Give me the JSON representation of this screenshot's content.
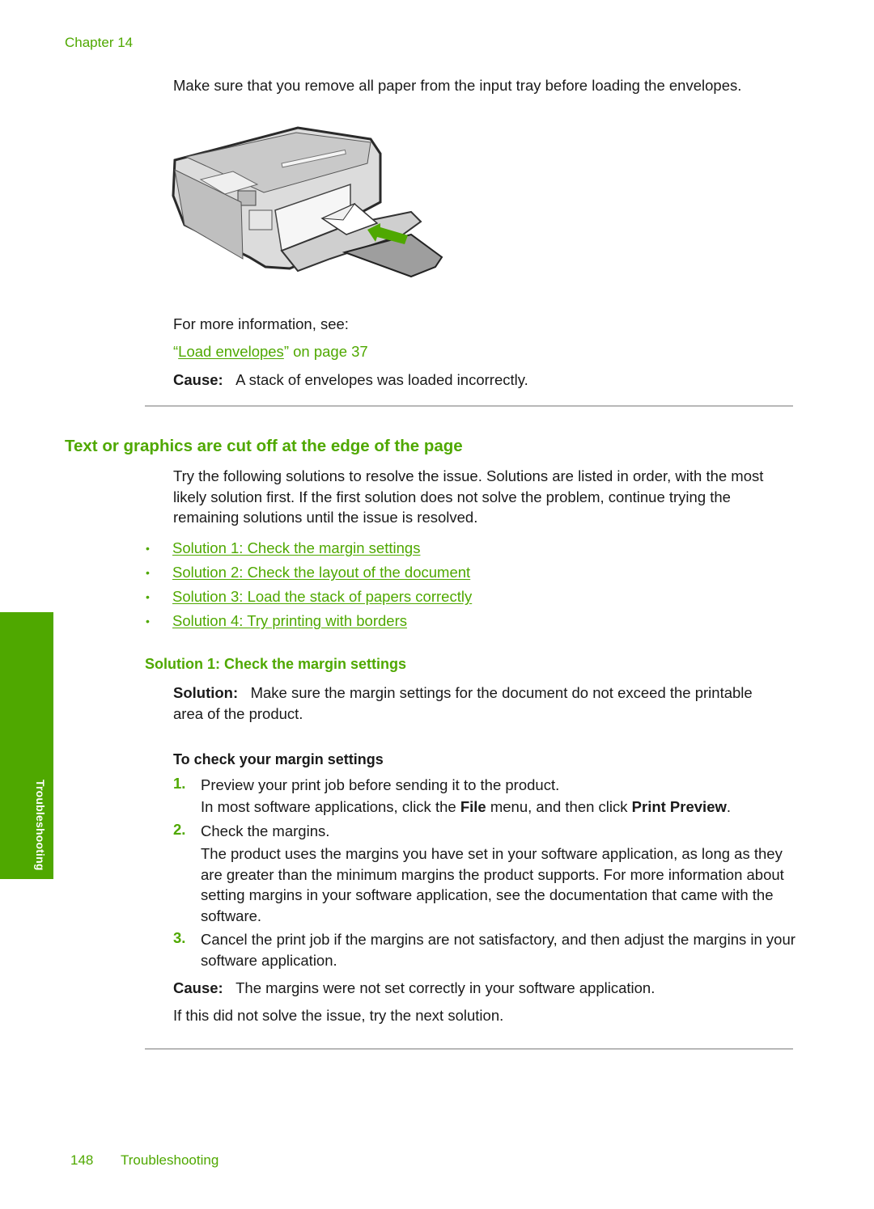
{
  "header": {
    "chapter": "Chapter 14"
  },
  "intro": {
    "remove_paper": "Make sure that you remove all paper from the input tray before loading the envelopes.",
    "figure_alt": "Printer with envelope being loaded into input tray (green arrow indicates direction)",
    "more_info": "For more information, see:",
    "link_open_quote": "“",
    "link_text": "Load envelopes",
    "link_suffix": "” on page 37",
    "cause_label": "Cause:",
    "cause_text": "A stack of envelopes was loaded incorrectly."
  },
  "section": {
    "title": "Text or graphics are cut off at the edge of the page",
    "intro": "Try the following solutions to resolve the issue. Solutions are listed in order, with the most likely solution first. If the first solution does not solve the problem, continue trying the remaining solutions until the issue is resolved.",
    "solutions": [
      {
        "label": "Solution 1: Check the margin settings"
      },
      {
        "label": "Solution 2: Check the layout of the document"
      },
      {
        "label": "Solution 3: Load the stack of papers correctly"
      },
      {
        "label": "Solution 4: Try printing with borders"
      }
    ],
    "bullet": "•"
  },
  "solution1": {
    "title": "Solution 1: Check the margin settings",
    "solution_label": "Solution:",
    "solution_text": "Make sure the margin settings for the document do not exceed the printable area of the product.",
    "procedure_title": "To check your margin settings",
    "steps": [
      {
        "num": "1.",
        "text": "Preview your print job before sending it to the product.",
        "detail_pre": "In most software applications, click the ",
        "detail_b1": "File",
        "detail_mid": " menu, and then click ",
        "detail_b2": "Print Preview",
        "detail_post": "."
      },
      {
        "num": "2.",
        "text": "Check the margins.",
        "detail": "The product uses the margins you have set in your software application, as long as they are greater than the minimum margins the product supports. For more information about setting margins in your software application, see the documentation that came with the software."
      },
      {
        "num": "3.",
        "text": "Cancel the print job if the margins are not satisfactory, and then adjust the margins in your software application."
      }
    ],
    "cause_label": "Cause:",
    "cause_text": "The margins were not set correctly in your software application.",
    "next": "If this did not solve the issue, try the next solution."
  },
  "side_tab": {
    "label": "Troubleshooting"
  },
  "footer": {
    "page_number": "148",
    "section": "Troubleshooting"
  },
  "colors": {
    "accent": "#4fa800",
    "text": "#1a1a1a",
    "rule": "#b8b8b8"
  }
}
